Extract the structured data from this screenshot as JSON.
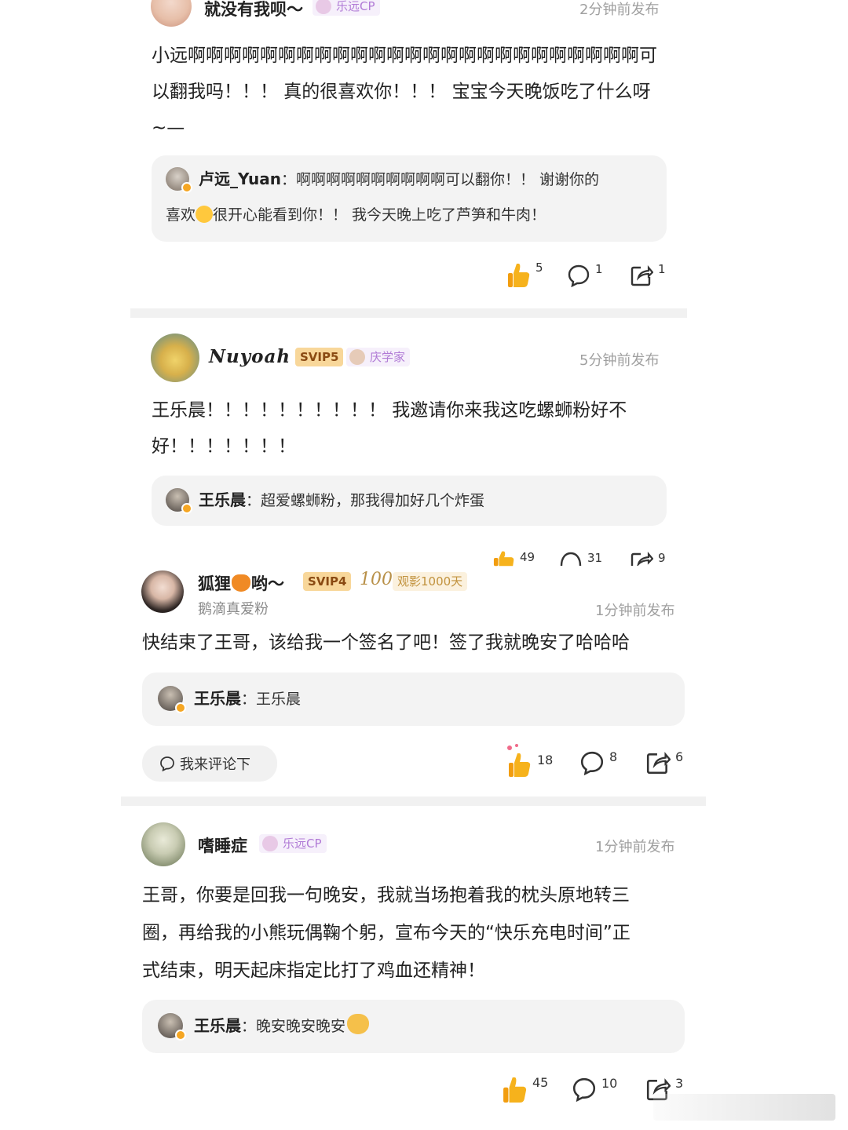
{
  "posts": [
    {
      "username": "就没有我呗～",
      "tag": "乐远CP",
      "time": "2分钟前发布",
      "text_lines": [
        "小远啊啊啊啊啊啊啊啊啊啊啊啊啊啊啊啊啊啊啊啊啊啊啊啊啊可",
        "以翻我吗！！！ 真的很喜欢你！！！ 宝宝今天晚饭吃了什么呀",
        "~—"
      ],
      "reply": {
        "name": "卢远_Yuan",
        "lines": [
          "啊啊啊啊啊啊啊啊啊啊可以翻你！！ 谢谢你的",
          "很开心能看到你！！ 我今天晚上吃了芦笋和牛肉！"
        ],
        "line2_prefix": "喜欢"
      },
      "likes": "5",
      "comments": "1",
      "shares": "1"
    },
    {
      "username": "Nuyoah",
      "svip": "SVIP5",
      "tag": "庆学家",
      "time": "5分钟前发布",
      "text_lines": [
        "王乐晨！！！！！！！！！！ 我邀请你来我这吃螺蛳粉好不",
        "好！！！！！！！"
      ],
      "reply": {
        "name": "王乐晨",
        "text": "超爱螺蛳粉，那我得加好几个炸蛋"
      },
      "likes": "49",
      "comments": "31",
      "shares": "9"
    },
    {
      "username": "狐狸",
      "username_suffix": "哟～",
      "svip": "SVIP4",
      "badge_num": "100",
      "tag": "观影1000天",
      "subtitle": "鹅滴真爱粉",
      "time": "1分钟前发布",
      "text": "快结束了王哥，该给我一个签名了吧！签了我就晚安了哈哈哈",
      "reply": {
        "name": "王乐晨",
        "text": "王乐晨"
      },
      "comment_button": "我来评论下",
      "likes": "18",
      "comments": "8",
      "shares": "6"
    },
    {
      "username": "嗜睡症",
      "tag": "乐远CP",
      "time": "1分钟前发布",
      "text_lines": [
        "王哥，你要是回我一句晚安，我就当场抱着我的枕头原地转三",
        "圈，再给我的小熊玩偶鞠个躬，宣布今天的“快乐充电时间”正",
        "式结束，明天起床指定比打了鸡血还精神！"
      ],
      "reply": {
        "name": "王乐晨",
        "text": "晚安晚安晚安"
      },
      "likes": "45",
      "comments": "10",
      "shares": "3"
    }
  ],
  "colors": {
    "svip_bg": "#f8d79a",
    "tag_text": "#b17bd6",
    "reply_bg": "#f3f3f3",
    "time_text": "#a0a0a0"
  }
}
